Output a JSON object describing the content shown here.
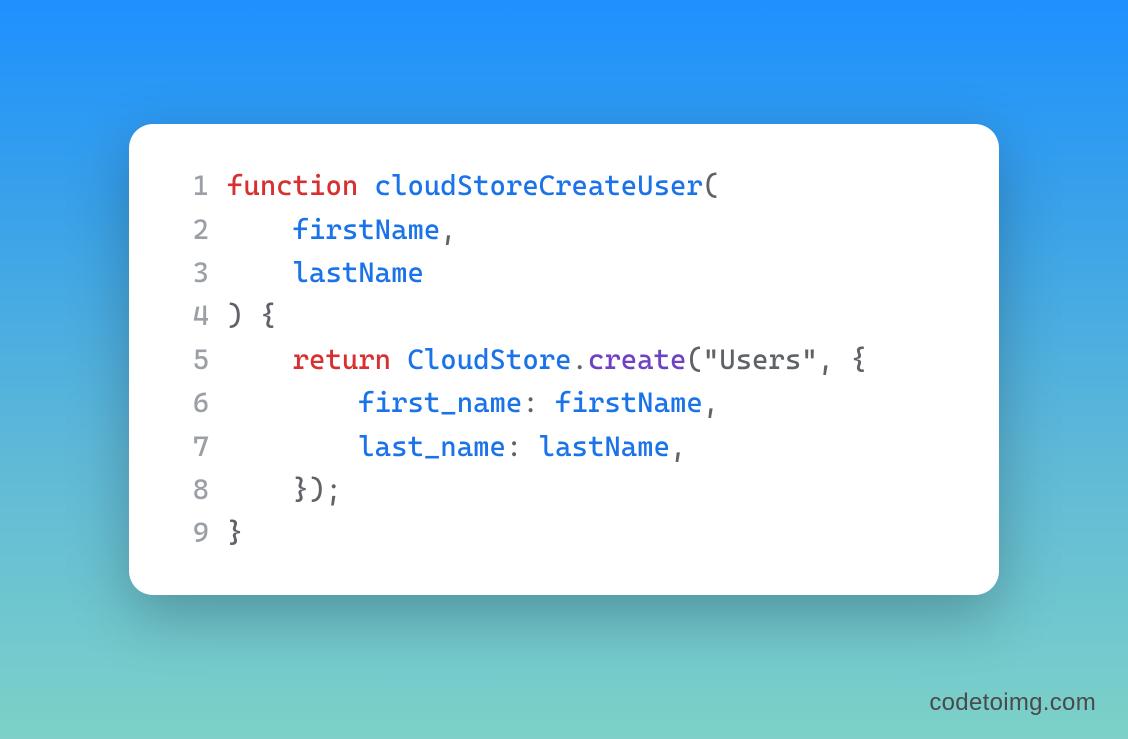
{
  "code": {
    "lines": [
      {
        "number": "1",
        "tokens": [
          {
            "text": "function",
            "cls": "tok-keyword"
          },
          {
            "text": " ",
            "cls": "tok-default"
          },
          {
            "text": "cloudStoreCreateUser",
            "cls": "tok-function"
          },
          {
            "text": "(",
            "cls": "tok-default"
          }
        ]
      },
      {
        "number": "2",
        "tokens": [
          {
            "text": "    ",
            "cls": "tok-default"
          },
          {
            "text": "firstName",
            "cls": "tok-param"
          },
          {
            "text": ",",
            "cls": "tok-default"
          }
        ]
      },
      {
        "number": "3",
        "tokens": [
          {
            "text": "    ",
            "cls": "tok-default"
          },
          {
            "text": "lastName",
            "cls": "tok-param"
          }
        ]
      },
      {
        "number": "4",
        "tokens": [
          {
            "text": ") {",
            "cls": "tok-default"
          }
        ]
      },
      {
        "number": "5",
        "tokens": [
          {
            "text": "    ",
            "cls": "tok-default"
          },
          {
            "text": "return",
            "cls": "tok-keyword"
          },
          {
            "text": " ",
            "cls": "tok-default"
          },
          {
            "text": "CloudStore",
            "cls": "tok-class"
          },
          {
            "text": ".",
            "cls": "tok-default"
          },
          {
            "text": "create",
            "cls": "tok-method"
          },
          {
            "text": "(",
            "cls": "tok-default"
          },
          {
            "text": "\"Users\"",
            "cls": "tok-string"
          },
          {
            "text": ", {",
            "cls": "tok-default"
          }
        ]
      },
      {
        "number": "6",
        "tokens": [
          {
            "text": "        ",
            "cls": "tok-default"
          },
          {
            "text": "first_name",
            "cls": "tok-prop"
          },
          {
            "text": ": ",
            "cls": "tok-default"
          },
          {
            "text": "firstName",
            "cls": "tok-param"
          },
          {
            "text": ",",
            "cls": "tok-default"
          }
        ]
      },
      {
        "number": "7",
        "tokens": [
          {
            "text": "        ",
            "cls": "tok-default"
          },
          {
            "text": "last_name",
            "cls": "tok-prop"
          },
          {
            "text": ": ",
            "cls": "tok-default"
          },
          {
            "text": "lastName",
            "cls": "tok-param"
          },
          {
            "text": ",",
            "cls": "tok-default"
          }
        ]
      },
      {
        "number": "8",
        "tokens": [
          {
            "text": "    });",
            "cls": "tok-default"
          }
        ]
      },
      {
        "number": "9",
        "tokens": [
          {
            "text": "}",
            "cls": "tok-default"
          }
        ]
      }
    ]
  },
  "watermark": "codetoimg.com"
}
